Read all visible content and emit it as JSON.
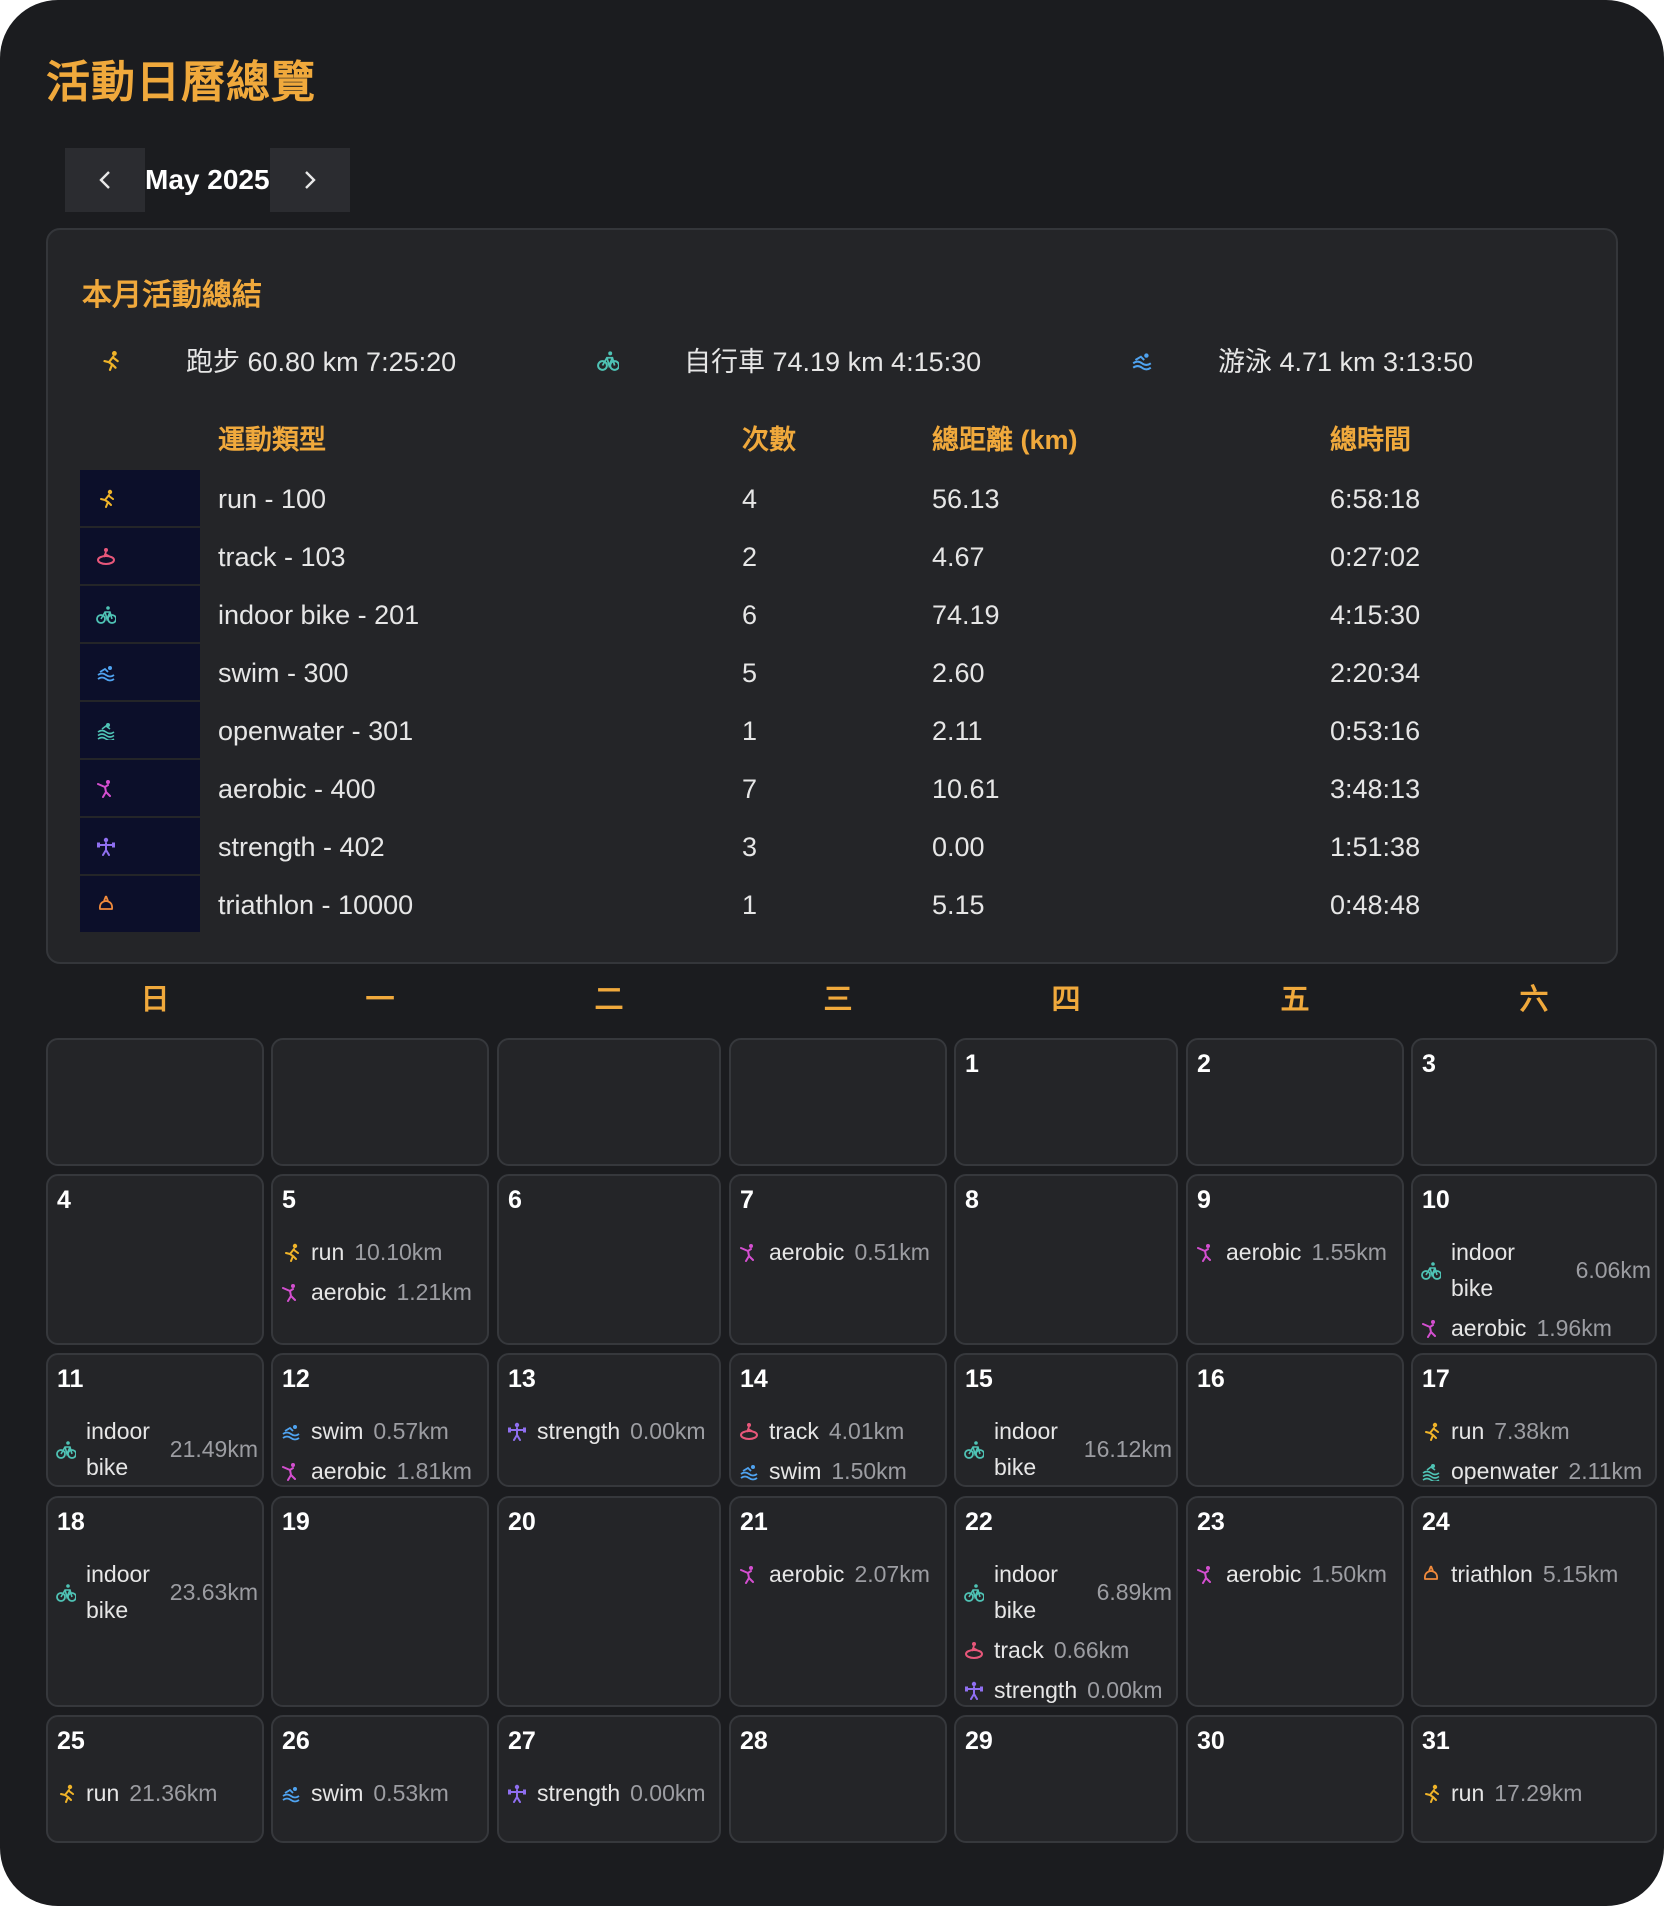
{
  "page": {
    "title": "活動日曆總覽"
  },
  "nav": {
    "prev_icon": "chevron-left-icon",
    "month_label": "May 2025",
    "next_icon": "chevron-right-icon"
  },
  "summary": {
    "title": "本月活動總結",
    "totals": [
      {
        "icon": "run-icon",
        "color": "#f0b429",
        "text": "跑步 60.80 km 7:25:20"
      },
      {
        "icon": "bike-icon",
        "color": "#4fc3b5",
        "text": "自行車 74.19 km 4:15:30"
      },
      {
        "icon": "swim-icon",
        "color": "#4fa3f0",
        "text": "游泳 4.71 km 3:13:50"
      }
    ],
    "headers": {
      "type": "運動類型",
      "count": "次數",
      "distance": "總距離 (km)",
      "time": "總時間"
    },
    "rows": [
      {
        "icon": "run-icon",
        "color": "#f0b429",
        "type": "run - 100",
        "count": "4",
        "distance": "56.13",
        "time": "6:58:18"
      },
      {
        "icon": "track-icon",
        "color": "#e8577a",
        "type": "track - 103",
        "count": "2",
        "distance": "4.67",
        "time": "0:27:02"
      },
      {
        "icon": "bike-icon",
        "color": "#4fc3b5",
        "type": "indoor bike - 201",
        "count": "6",
        "distance": "74.19",
        "time": "4:15:30"
      },
      {
        "icon": "swim-icon",
        "color": "#4fa3f0",
        "type": "swim - 300",
        "count": "5",
        "distance": "2.60",
        "time": "2:20:34"
      },
      {
        "icon": "openwater-icon",
        "color": "#4fc3b5",
        "type": "openwater - 301",
        "count": "1",
        "distance": "2.11",
        "time": "0:53:16"
      },
      {
        "icon": "aerobic-icon",
        "color": "#d44fd0",
        "type": "aerobic - 400",
        "count": "7",
        "distance": "10.61",
        "time": "3:48:13"
      },
      {
        "icon": "strength-icon",
        "color": "#8f6ff0",
        "type": "strength - 402",
        "count": "3",
        "distance": "0.00",
        "time": "1:51:38"
      },
      {
        "icon": "triathlon-icon",
        "color": "#f08a3c",
        "type": "triathlon - 10000",
        "count": "1",
        "distance": "5.15",
        "time": "0:48:48"
      }
    ]
  },
  "calendar": {
    "weekdays": [
      "日",
      "一",
      "二",
      "三",
      "四",
      "五",
      "六"
    ],
    "days": [
      {
        "day": "",
        "acts": []
      },
      {
        "day": "",
        "acts": []
      },
      {
        "day": "",
        "acts": []
      },
      {
        "day": "",
        "acts": []
      },
      {
        "day": "1",
        "acts": []
      },
      {
        "day": "2",
        "acts": []
      },
      {
        "day": "3",
        "acts": []
      },
      {
        "day": "4",
        "acts": []
      },
      {
        "day": "5",
        "acts": [
          {
            "icon": "run-icon",
            "color": "#f0b429",
            "name": "run",
            "km": "10.10km"
          },
          {
            "icon": "aerobic-icon",
            "color": "#d44fd0",
            "name": "aerobic",
            "km": "1.21km"
          }
        ]
      },
      {
        "day": "6",
        "acts": []
      },
      {
        "day": "7",
        "acts": [
          {
            "icon": "aerobic-icon",
            "color": "#d44fd0",
            "name": "aerobic",
            "km": "0.51km"
          }
        ]
      },
      {
        "day": "8",
        "acts": []
      },
      {
        "day": "9",
        "acts": [
          {
            "icon": "aerobic-icon",
            "color": "#d44fd0",
            "name": "aerobic",
            "km": "1.55km"
          }
        ]
      },
      {
        "day": "10",
        "acts": [
          {
            "icon": "bike-icon",
            "color": "#4fc3b5",
            "name": "indoor bike",
            "km": "6.06km"
          },
          {
            "icon": "aerobic-icon",
            "color": "#d44fd0",
            "name": "aerobic",
            "km": "1.96km"
          }
        ]
      },
      {
        "day": "11",
        "acts": [
          {
            "icon": "bike-icon",
            "color": "#4fc3b5",
            "name": "indoor bike",
            "km": "21.49km"
          }
        ]
      },
      {
        "day": "12",
        "acts": [
          {
            "icon": "swim-icon",
            "color": "#4fa3f0",
            "name": "swim",
            "km": "0.57km"
          },
          {
            "icon": "aerobic-icon",
            "color": "#d44fd0",
            "name": "aerobic",
            "km": "1.81km"
          }
        ]
      },
      {
        "day": "13",
        "acts": [
          {
            "icon": "strength-icon",
            "color": "#8f6ff0",
            "name": "strength",
            "km": "0.00km"
          }
        ]
      },
      {
        "day": "14",
        "acts": [
          {
            "icon": "track-icon",
            "color": "#e8577a",
            "name": "track",
            "km": "4.01km"
          },
          {
            "icon": "swim-icon",
            "color": "#4fa3f0",
            "name": "swim",
            "km": "1.50km"
          }
        ]
      },
      {
        "day": "15",
        "acts": [
          {
            "icon": "bike-icon",
            "color": "#4fc3b5",
            "name": "indoor bike",
            "km": "16.12km"
          }
        ]
      },
      {
        "day": "16",
        "acts": []
      },
      {
        "day": "17",
        "acts": [
          {
            "icon": "run-icon",
            "color": "#f0b429",
            "name": "run",
            "km": "7.38km"
          },
          {
            "icon": "openwater-icon",
            "color": "#4fc3b5",
            "name": "openwater",
            "km": "2.11km"
          }
        ]
      },
      {
        "day": "18",
        "acts": [
          {
            "icon": "bike-icon",
            "color": "#4fc3b5",
            "name": "indoor bike",
            "km": "23.63km"
          }
        ]
      },
      {
        "day": "19",
        "acts": []
      },
      {
        "day": "20",
        "acts": []
      },
      {
        "day": "21",
        "acts": [
          {
            "icon": "aerobic-icon",
            "color": "#d44fd0",
            "name": "aerobic",
            "km": "2.07km"
          }
        ]
      },
      {
        "day": "22",
        "acts": [
          {
            "icon": "bike-icon",
            "color": "#4fc3b5",
            "name": "indoor bike",
            "km": "6.89km"
          },
          {
            "icon": "track-icon",
            "color": "#e8577a",
            "name": "track",
            "km": "0.66km"
          },
          {
            "icon": "strength-icon",
            "color": "#8f6ff0",
            "name": "strength",
            "km": "0.00km"
          }
        ]
      },
      {
        "day": "23",
        "acts": [
          {
            "icon": "aerobic-icon",
            "color": "#d44fd0",
            "name": "aerobic",
            "km": "1.50km"
          }
        ]
      },
      {
        "day": "24",
        "acts": [
          {
            "icon": "triathlon-icon",
            "color": "#f08a3c",
            "name": "triathlon",
            "km": "5.15km"
          }
        ]
      },
      {
        "day": "25",
        "acts": [
          {
            "icon": "run-icon",
            "color": "#f0b429",
            "name": "run",
            "km": "21.36km"
          }
        ]
      },
      {
        "day": "26",
        "acts": [
          {
            "icon": "swim-icon",
            "color": "#4fa3f0",
            "name": "swim",
            "km": "0.53km"
          }
        ]
      },
      {
        "day": "27",
        "acts": [
          {
            "icon": "strength-icon",
            "color": "#8f6ff0",
            "name": "strength",
            "km": "0.00km"
          }
        ]
      },
      {
        "day": "28",
        "acts": []
      },
      {
        "day": "29",
        "acts": []
      },
      {
        "day": "30",
        "acts": []
      },
      {
        "day": "31",
        "acts": [
          {
            "icon": "run-icon",
            "color": "#f0b429",
            "name": "run",
            "km": "17.29km"
          }
        ]
      }
    ]
  }
}
